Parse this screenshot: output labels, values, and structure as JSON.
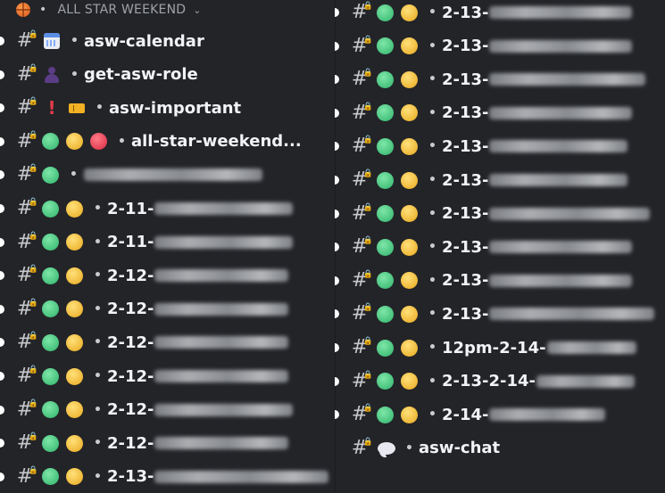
{
  "category": {
    "label": "ALL STAR WEEKEND",
    "icon": "basketball-icon"
  },
  "colors": {
    "background": "#232428",
    "green": "#2fb36b",
    "yellow": "#e8a81c",
    "red": "#d9283f"
  },
  "left_channels": [
    {
      "name": "asw-calendar",
      "icon": "calendar-icon",
      "unread": true
    },
    {
      "name": "get-asw-role",
      "icon": "person-icon",
      "unread": true
    },
    {
      "name": "asw-important",
      "icon": "exclamation-ticket-icon",
      "unread": true
    },
    {
      "name": "all-star-weekend...",
      "icon": "green-yellow-red-circles",
      "unread": true
    },
    {
      "name": "",
      "icon": "green-circle",
      "unread": true
    },
    {
      "name": "2-11-",
      "icon": "green-yellow-circles",
      "unread": true
    },
    {
      "name": "2-11-",
      "icon": "green-yellow-circles",
      "unread": true
    },
    {
      "name": "2-12-",
      "icon": "green-yellow-circles",
      "unread": true
    },
    {
      "name": "2-12-",
      "icon": "green-yellow-circles",
      "unread": true
    },
    {
      "name": "2-12-",
      "icon": "green-yellow-circles",
      "unread": true
    },
    {
      "name": "2-12-",
      "icon": "green-yellow-circles",
      "unread": true
    },
    {
      "name": "2-12-",
      "icon": "green-yellow-circles",
      "unread": true
    },
    {
      "name": "2-12-",
      "icon": "green-yellow-circles",
      "unread": true
    },
    {
      "name": "2-13-",
      "icon": "green-yellow-circles",
      "unread": true
    }
  ],
  "right_channels": [
    {
      "name": "2-13-",
      "icon": "green-yellow-circles",
      "unread": true
    },
    {
      "name": "2-13-",
      "icon": "green-yellow-circles",
      "unread": true
    },
    {
      "name": "2-13-",
      "icon": "green-yellow-circles",
      "unread": true
    },
    {
      "name": "2-13-",
      "icon": "green-yellow-circles",
      "unread": true
    },
    {
      "name": "2-13-",
      "icon": "green-yellow-circles",
      "unread": true
    },
    {
      "name": "2-13-",
      "icon": "green-yellow-circles",
      "unread": true
    },
    {
      "name": "2-13-",
      "icon": "green-yellow-circles",
      "unread": true
    },
    {
      "name": "2-13-",
      "icon": "green-yellow-circles",
      "unread": true
    },
    {
      "name": "2-13-",
      "icon": "green-yellow-circles",
      "unread": true
    },
    {
      "name": "2-13-",
      "icon": "green-yellow-circles",
      "unread": true
    },
    {
      "name": "12pm-2-14-",
      "icon": "green-yellow-circles",
      "unread": true
    },
    {
      "name": "2-13-2-14-",
      "icon": "green-yellow-circles",
      "unread": true
    },
    {
      "name": "2-14-",
      "icon": "green-yellow-circles",
      "unread": true
    },
    {
      "name": "asw-chat",
      "icon": "speech-bubble-icon",
      "unread": false
    }
  ]
}
